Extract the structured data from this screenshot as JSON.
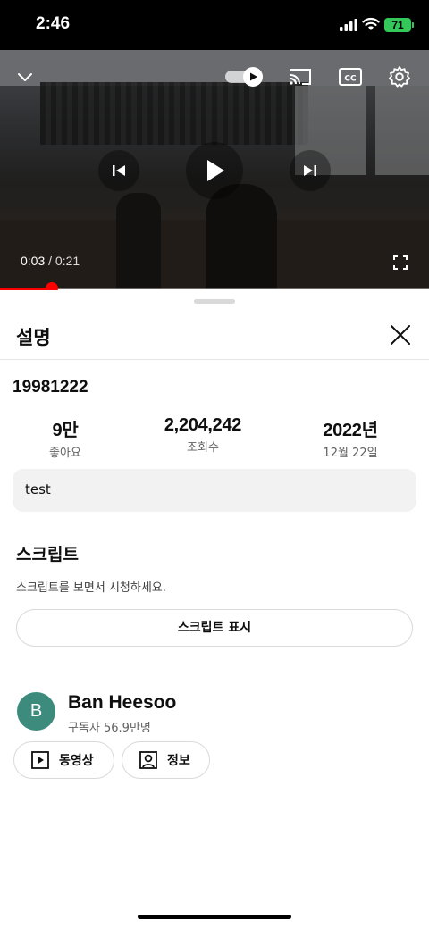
{
  "status_bar": {
    "time": "2:46",
    "battery": "71"
  },
  "player": {
    "current_time": "0:03",
    "separator": " / ",
    "duration": "0:21",
    "progress_fraction": 0.12,
    "accent_color": "#ff0000"
  },
  "sheet": {
    "title": "설명",
    "video_title": "19981222",
    "stats": {
      "likes_value": "9만",
      "likes_label": "좋아요",
      "views_value": "2,204,242",
      "views_label": "조회수",
      "date_value": "2022년",
      "date_label": "12월 22일"
    },
    "description": "test",
    "transcript": {
      "heading": "스크립트",
      "hint": "스크립트를 보면서 시청하세요.",
      "button_label": "스크립트 표시"
    },
    "channel": {
      "avatar_letter": "B",
      "avatar_color": "#3d8b7d",
      "name": "Ban Heesoo",
      "subscribers": "구독자 56.9만명",
      "videos_label": "동영상",
      "about_label": "정보"
    }
  }
}
